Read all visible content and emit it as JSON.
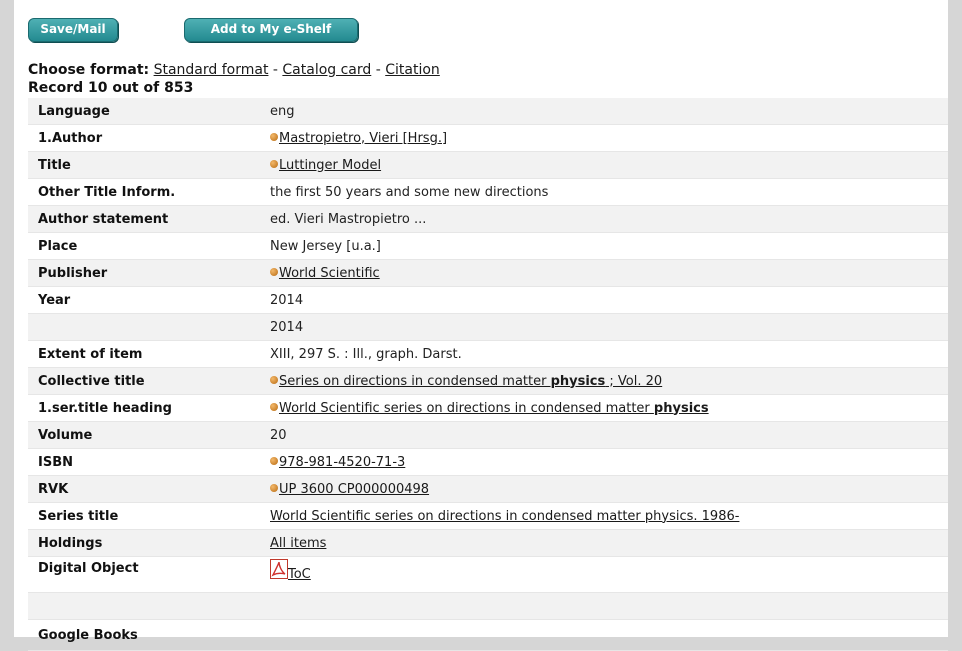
{
  "toolbar": {
    "save_label": "Save/Mail",
    "shelf_label": "Add to My e-Shelf"
  },
  "format": {
    "prefix": "Choose format:",
    "standard": "Standard format",
    "sep1": " - ",
    "catalog": "Catalog card",
    "sep2": " - ",
    "citation": "Citation"
  },
  "record": "Record 10 out of 853",
  "rows": [
    {
      "label": "Language",
      "value": "eng"
    },
    {
      "label": "1.Author",
      "value": "Mastropietro, Vieri [Hrsg.]"
    },
    {
      "label": "Title",
      "value": "Luttinger Model"
    },
    {
      "label": "Other Title Inform.",
      "value": "the first 50 years and some new directions"
    },
    {
      "label": "Author statement",
      "value": "ed. Vieri Mastropietro ..."
    },
    {
      "label": "Place",
      "value": "New Jersey [u.a.]"
    },
    {
      "label": "Publisher",
      "value": "World Scientific"
    },
    {
      "label": "Year",
      "value": "2014"
    },
    {
      "label": "",
      "value": "2014"
    },
    {
      "label": "Extent of item",
      "value": "XIII, 297 S. : Ill., graph. Darst."
    },
    {
      "label": "Collective title",
      "value_pre": "Series on directions in condensed matter ",
      "value_bold": "physics",
      "value_post": " ; Vol. 20"
    },
    {
      "label": "1.ser.title heading",
      "value_pre": "World Scientific series on directions in condensed matter ",
      "value_bold": "physics",
      "value_post": " "
    },
    {
      "label": "Volume",
      "value": "20"
    },
    {
      "label": "ISBN",
      "value": "978-981-4520-71-3"
    },
    {
      "label": "RVK",
      "value": "UP 3600 CP000000498 "
    },
    {
      "label": "Series title",
      "value": "World Scientific series on directions in condensed matter physics. 1986-"
    },
    {
      "label": "Holdings",
      "value": "All items"
    },
    {
      "label": "Digital Object",
      "value": "ToC",
      "icon": "pdf-icon"
    },
    {
      "label": "",
      "value": ""
    },
    {
      "label": "Google Books",
      "value": ""
    }
  ]
}
